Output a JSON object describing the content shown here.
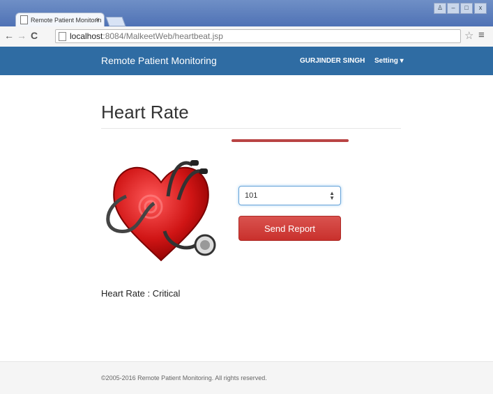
{
  "browser": {
    "tab_title": "Remote Patient Monitorin",
    "tab_close": "×",
    "url_host": "localhost",
    "url_path": ":8084/MalkeetWeb/heartbeat.jsp",
    "nav_back": "←",
    "nav_forward": "→",
    "nav_reload": "C",
    "star": "☆",
    "menu": "≡",
    "win_user": "♙",
    "win_min": "–",
    "win_max": "□",
    "win_close": "x"
  },
  "navbar": {
    "brand": "Remote Patient Monitoring",
    "user": "GURJINDER SINGH",
    "setting": "Setting ▾",
    "color": "#2f6ca3"
  },
  "main": {
    "title": "Heart Rate",
    "input_value": "101",
    "send_label": "Send Report",
    "status": "Heart Rate : Critical"
  },
  "footer": {
    "copyright": "©2005-2016 Remote Patient Monitoring. All rights reserved."
  },
  "icons": [
    "document-icon",
    "star-icon",
    "menu-icon",
    "heart-stethoscope-icon",
    "spinner-arrows-icon"
  ]
}
